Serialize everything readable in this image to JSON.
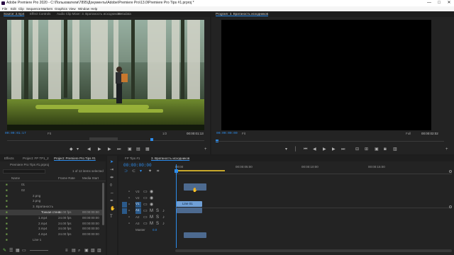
{
  "window": {
    "title": "Adobe Premiere Pro 2020 - C:\\Пользователи\\7895\\Документы\\Adobe\\Premiere Pro\\13.0\\Premiere Pro Tips #1.prproj *",
    "minimize": "—",
    "maximize": "□",
    "close": "✕"
  },
  "menu": [
    "File",
    "Edit",
    "Clip",
    "Sequence",
    "Markers",
    "Graphics",
    "View",
    "Window",
    "Help"
  ],
  "source_panel": {
    "tabs": [
      "Source: 2.mp4",
      "Effect Controls",
      "Audio Clip Mixer: 3. Вратаность исходников",
      "Metadata"
    ],
    "timecode_in": "00:00:01:17",
    "fit": "Fit",
    "fraction": "1/2",
    "timecode_duration": "00:00:01:13"
  },
  "program_panel": {
    "tab": "Program: 3. Вратаность исходников",
    "timecode": "00:00:00:00",
    "fit": "Fit",
    "fraction": "Full",
    "duration": "00:00:02:02"
  },
  "project_panel": {
    "tabs": [
      "Effects",
      "Project: FP TP1_2",
      "Project: Premiere Pro Tips #1"
    ],
    "project_file": "Premiere Pro Tips #1.prproj",
    "items_selected": "1 of 12 items selected",
    "columns": [
      "Name",
      "Frame Rate",
      "Media Start"
    ],
    "rows": [
      {
        "name": "01",
        "fps": "",
        "start": ""
      },
      {
        "name": "02",
        "fps": "",
        "start": ""
      },
      {
        "name": "2.png",
        "fps": "",
        "start": ""
      },
      {
        "name": "2.png",
        "fps": "",
        "start": ""
      },
      {
        "name": "3. Вратаность",
        "fps": "",
        "start": ""
      },
      {
        "name": "Тонкая стена",
        "fps": "24.00 fps",
        "start": "00:00:00:00"
      },
      {
        "name": "1.mp4",
        "fps": "24.00 fps",
        "start": "00:00:00:00"
      },
      {
        "name": "2.mp4",
        "fps": "24.00 fps",
        "start": "00:00:00:00"
      },
      {
        "name": "3.mp4",
        "fps": "24.00 fps",
        "start": "00:00:00:00"
      },
      {
        "name": "4.mp4",
        "fps": "24.00 fps",
        "start": "00:00:00:00"
      },
      {
        "name": "Line 1",
        "fps": "",
        "start": ""
      }
    ]
  },
  "timeline_panel": {
    "tabs": [
      "FP Tips #1",
      "3. Вратаность исходников"
    ],
    "timecode": "00:00:00:00",
    "ruler": [
      "00:00",
      "00:00:05:00",
      "00:00:10:00",
      "00:00:15:00"
    ],
    "tracks": [
      "V3",
      "V2",
      "V1",
      "A1",
      "A2",
      "A3",
      "Master"
    ],
    "master_value": "0.0",
    "clip_label": "Line 01"
  },
  "colors": {
    "accent": "#2d8ceb",
    "clip_video": "#4d6a8f",
    "clip_selected": "#6f9fd6"
  }
}
